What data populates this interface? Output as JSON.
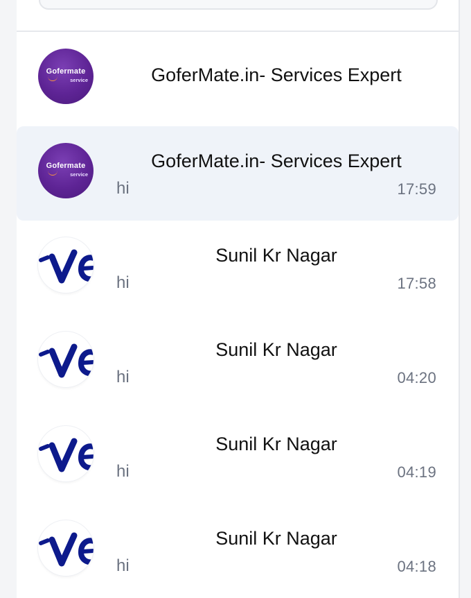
{
  "search": {
    "placeholder": ""
  },
  "conversations": [
    {
      "name": "GoferMate.in- Services Expert",
      "preview": "",
      "time": "",
      "avatar": "gofermate-service-logo",
      "active": false
    },
    {
      "name": "GoferMate.in- Services Expert",
      "preview": "hi",
      "time": "17:59",
      "avatar": "gofermate-service-logo",
      "active": true
    },
    {
      "name": "Sunil Kr Nagar",
      "preview": "hi",
      "time": "17:58",
      "avatar": "ve-logo",
      "active": false
    },
    {
      "name": "Sunil Kr Nagar",
      "preview": "hi",
      "time": "04:20",
      "avatar": "ve-logo",
      "active": false
    },
    {
      "name": "Sunil Kr Nagar",
      "preview": "hi",
      "time": "04:19",
      "avatar": "ve-logo",
      "active": false
    },
    {
      "name": "Sunil Kr Nagar",
      "preview": "hi",
      "time": "04:18",
      "avatar": "ve-logo",
      "active": false
    }
  ],
  "brand": {
    "logo_main": "Gofermate",
    "logo_sub": "service"
  },
  "colors": {
    "active_bg": "#eff3f9",
    "brand_purple": "#5e2495",
    "logo_blue": "#0d1a8c",
    "muted_text": "#6b7280"
  }
}
